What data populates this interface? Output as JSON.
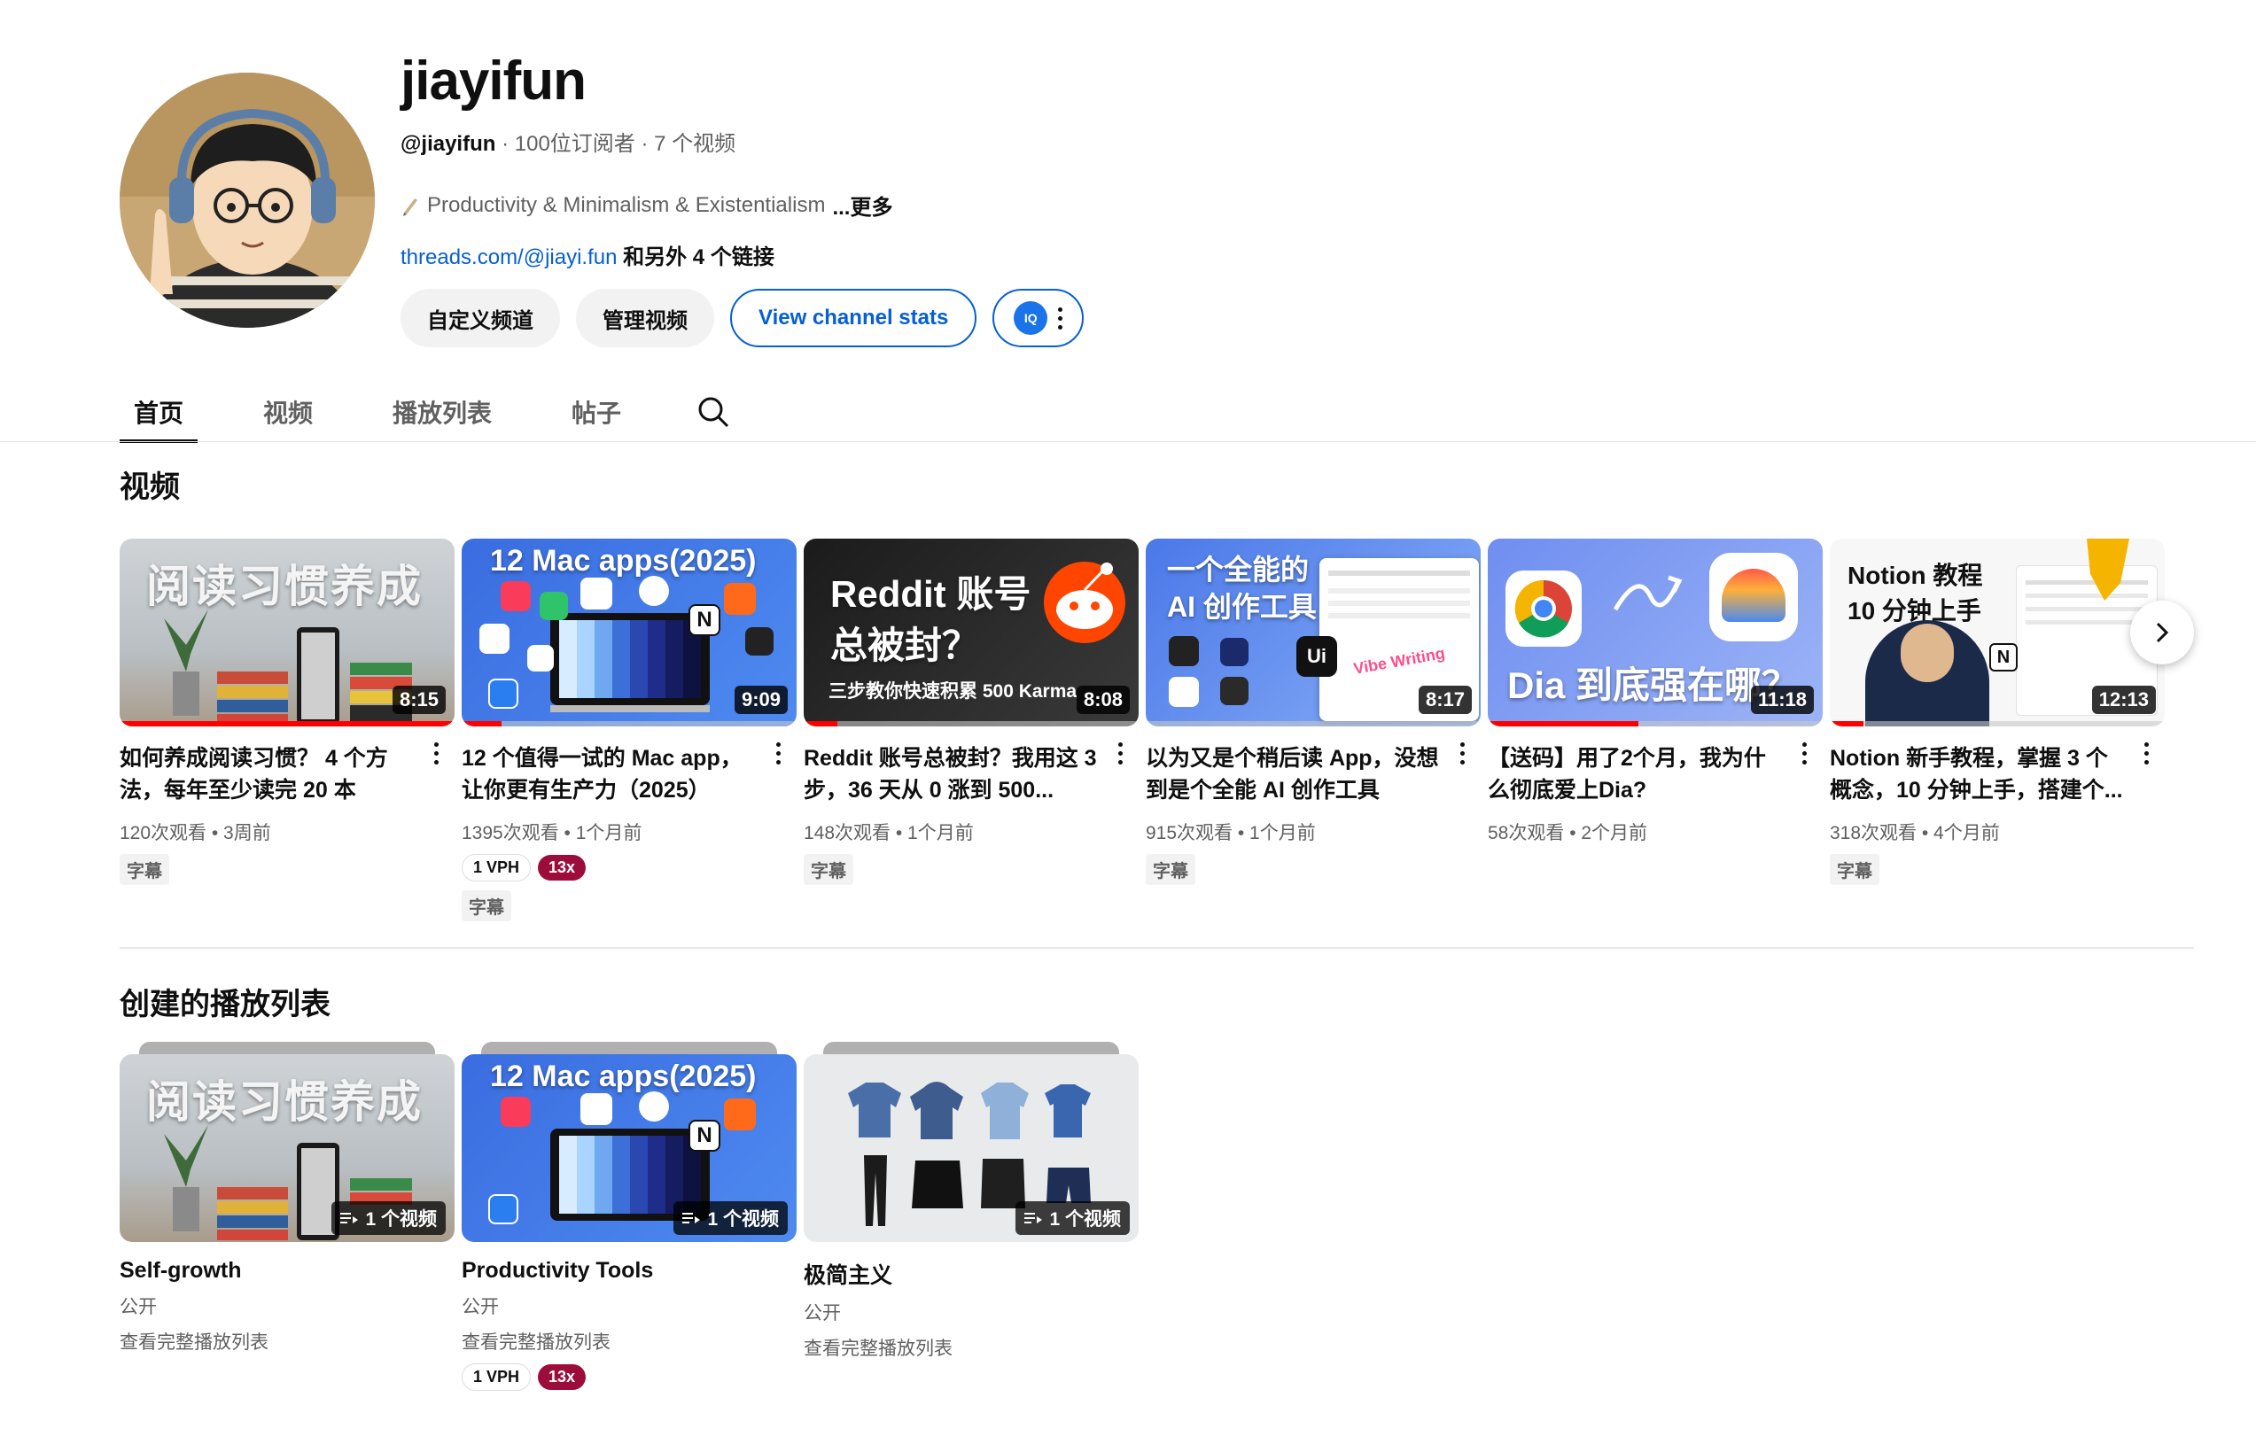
{
  "channel": {
    "name": "jiayifun",
    "handle": "@jiayifun",
    "meta": " · 100位订阅者 · 7 个视频",
    "description": "Productivity & Minimalism & Existentialism",
    "more": "...更多",
    "link": "threads.com/@jiayi.fun",
    "link_suffix": " 和另外 4 个链接",
    "ext_badge": "IQ"
  },
  "actions": {
    "customize": "自定义频道",
    "manage": "管理视频",
    "stats": "View channel stats"
  },
  "tabs": [
    "首页",
    "视频",
    "播放列表",
    "帖子"
  ],
  "sections": {
    "videos": "视频",
    "playlists": "创建的播放列表"
  },
  "videos": [
    {
      "thumb_text": "阅读习惯养成",
      "duration": "8:15",
      "progress": 1.0,
      "title": "如何养成阅读习惯？ 4 个方法，每年至少读完 20 本",
      "meta": "120次观看 • 3周前",
      "cc": "字幕"
    },
    {
      "thumb_text": "12 Mac apps(2025)",
      "duration": "9:09",
      "progress": 0.12,
      "title": "12 个值得一试的 Mac app，让你更有生产力（2025）",
      "meta": "1395次观看 • 1个月前",
      "vph": "1 VPH",
      "mult": "13x",
      "cc": "字幕"
    },
    {
      "thumb_text": "Reddit 账号总被封？",
      "thumb_sub": "三步教你快速积累 500 Karma",
      "duration": "8:08",
      "progress": 0.1,
      "title": "Reddit 账号总被封？我用这 3 步，36 天从 0 涨到 500...",
      "meta": "148次观看 • 1个月前",
      "cc": "字幕"
    },
    {
      "thumb_text": "一个全能的 AI 创作工具",
      "thumb_sub": "Vibe Writing",
      "duration": "8:17",
      "progress": 0.0,
      "title": "以为又是个稍后读 App，没想到是个全能 AI 创作工具",
      "meta": "915次观看 • 1个月前",
      "cc": "字幕"
    },
    {
      "thumb_text": "Dia 到底强在哪？",
      "duration": "11:18",
      "progress": 0.45,
      "title": "【送码】用了2个月，我为什么彻底爱上Dia?",
      "meta": "58次观看 • 2个月前"
    },
    {
      "thumb_text": "Notion 教程",
      "thumb_sub": "10 分钟上手",
      "duration": "12:13",
      "progress": 0.1,
      "title": "Notion 新手教程，掌握 3 个概念，10 分钟上手，搭建个...",
      "meta": "318次观看 • 4个月前",
      "cc": "字幕"
    }
  ],
  "playlists": [
    {
      "thumb_text": "阅读习惯养成",
      "count": "1 个视频",
      "title": "Self-growth",
      "visibility": "公开",
      "view_all": "查看完整播放列表"
    },
    {
      "thumb_text": "12 Mac apps(2025)",
      "count": "1 个视频",
      "title": "Productivity Tools",
      "visibility": "公开",
      "view_all": "查看完整播放列表",
      "vph": "1 VPH",
      "mult": "13x"
    },
    {
      "thumb_text": "",
      "count": "1 个视频",
      "title": "极简主义",
      "visibility": "公开",
      "view_all": "查看完整播放列表"
    }
  ],
  "colors": {
    "accent": "#065fd4",
    "progress": "#ff0000",
    "mult_badge": "#9d0d3b"
  }
}
